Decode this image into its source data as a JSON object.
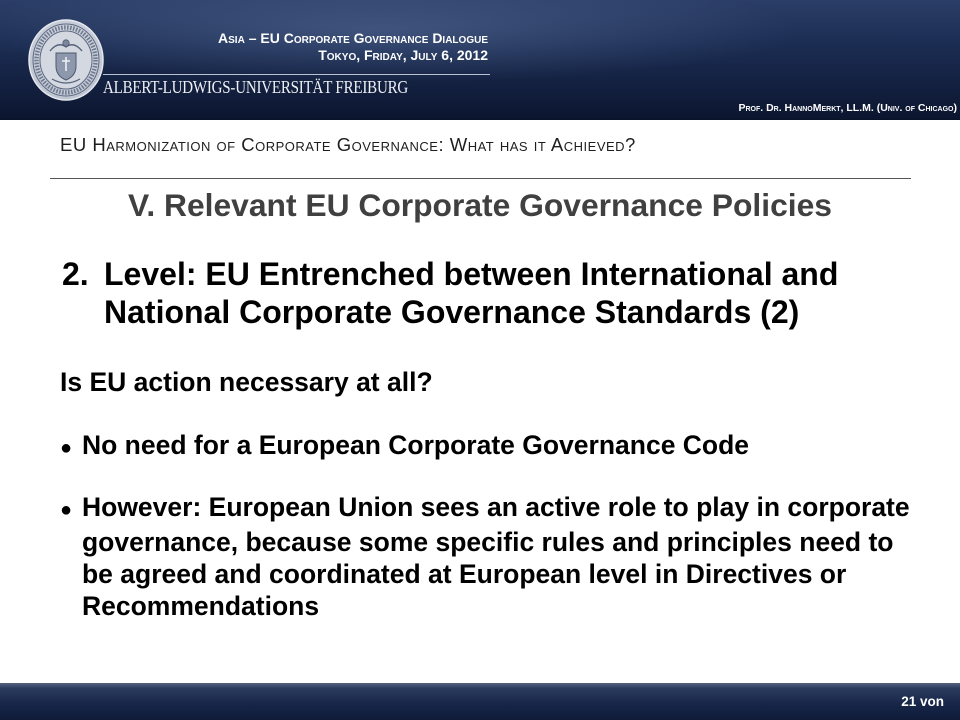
{
  "header": {
    "event_title": "Asia – EU Corporate Governance Dialogue",
    "event_date": "Tokyo, Friday, July 6, 2012",
    "university_name": "ALBERT-LUDWIGS-UNIVERSITÄT FREIBURG",
    "presenter": "Prof. Dr. HannoMerkt, LL.M. (Univ. of Chicago)",
    "logo_icon": "university-seal-icon"
  },
  "section_title": "EU Harmonization of Corporate Governance: What has it Achieved?",
  "slide": {
    "heading": "V. Relevant EU Corporate Governance Policies",
    "subheading": {
      "number": "2.",
      "lines": [
        "Level: EU Entrenched between International and",
        "National Corporate Governance Standards (2)"
      ]
    },
    "question": "Is EU action necessary at all?",
    "bullets": [
      {
        "marker": "●",
        "lines": [
          "No need for a European Corporate Governance Code"
        ]
      },
      {
        "marker": "●",
        "lines": [
          "However: European Union sees an active role to play in corporate",
          "governance, because some specific rules and principles need to",
          "be agreed and coordinated at European level in Directives or",
          "Recommendations"
        ]
      }
    ]
  },
  "footer": {
    "page_label": "21 von"
  },
  "colors": {
    "header_background": "#1b2c52",
    "footer_background": "#172649",
    "header_text": "#ffffff",
    "heading_text": "#404040",
    "body_text": "#000000"
  }
}
